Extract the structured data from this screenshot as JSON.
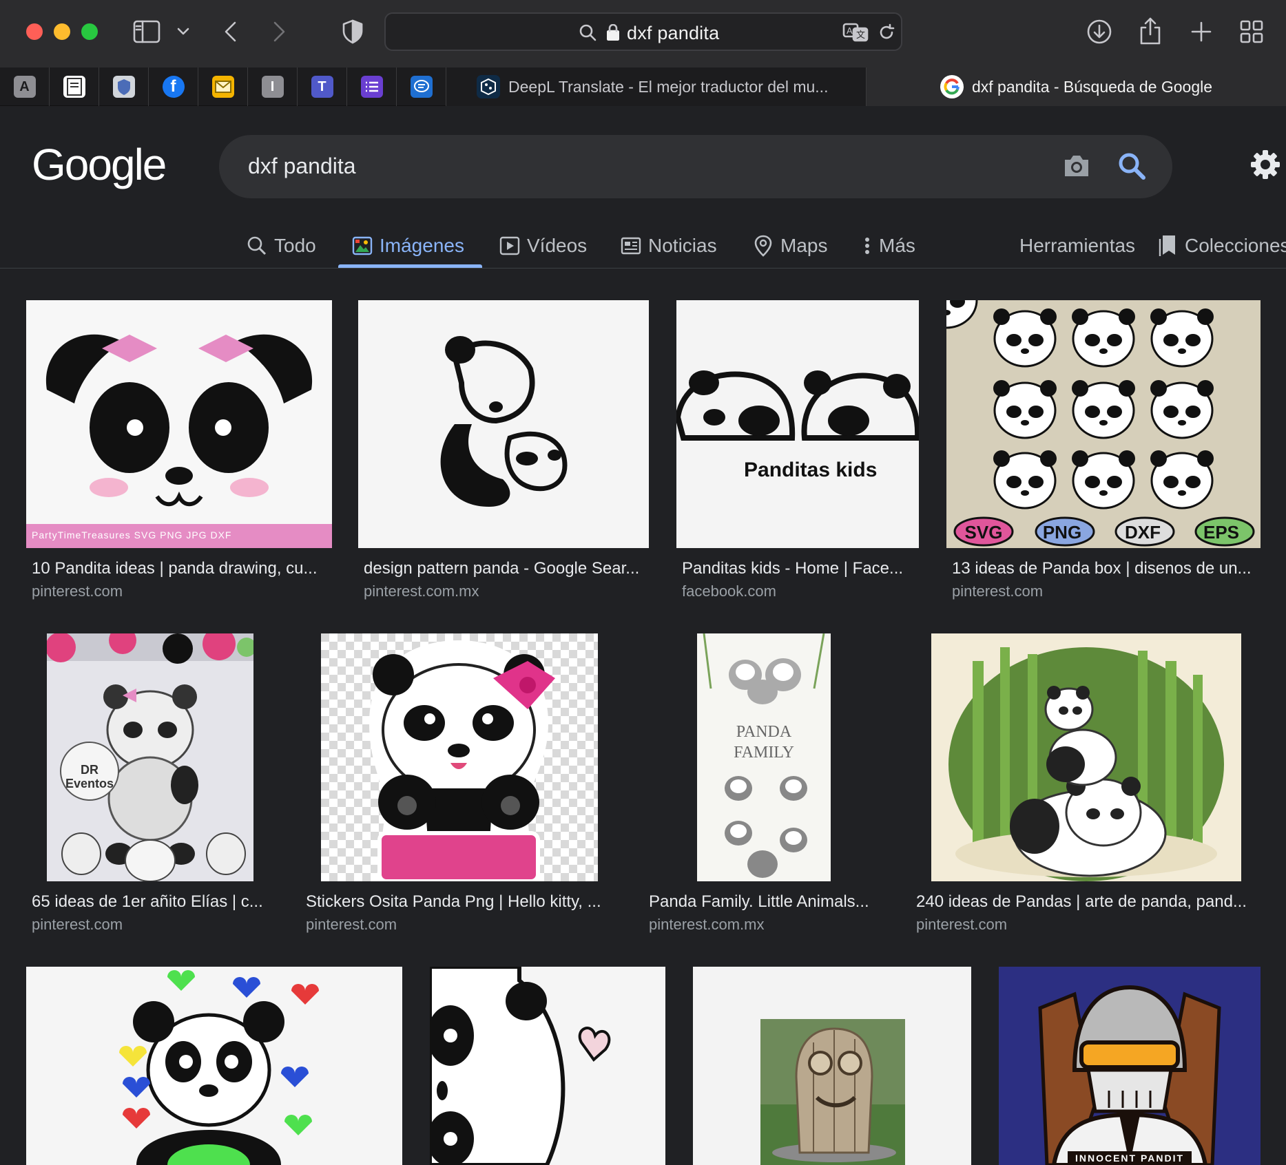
{
  "browser": {
    "url": "dxf pandita",
    "tabs": {
      "inactive_title": "DeepL Translate - El mejor traductor del mu...",
      "active_title": "dxf pandita - Búsqueda de Google"
    },
    "pinned": [
      "A",
      "",
      "",
      "",
      "",
      "I",
      "",
      "",
      ""
    ]
  },
  "google": {
    "logo": "Google",
    "query": "dxf pandita",
    "nav": {
      "all": "Todo",
      "images": "Imágenes",
      "videos": "Vídeos",
      "news": "Noticias",
      "maps": "Maps",
      "more": "Más",
      "tools": "Herramientas",
      "collections": "Colecciones"
    }
  },
  "results": [
    {
      "title": "10 Pandita ideas | panda drawing, cu...",
      "source": "pinterest.com",
      "overlay": "PartyTimeTreasures   SVG  PNG  JPG  DXF"
    },
    {
      "title": "design pattern panda - Google Sear...",
      "source": "pinterest.com.mx"
    },
    {
      "title": "Panditas kids - Home | Face...",
      "source": "facebook.com",
      "overlay": "Panditas kids"
    },
    {
      "title": "13 ideas de Panda box | disenos de un...",
      "source": "pinterest.com",
      "tags": [
        "SVG",
        "PNG",
        "DXF",
        "EPS"
      ]
    },
    {
      "title": "65 ideas de 1er añito Elías | c...",
      "source": "pinterest.com",
      "overlay": "DR Eventos"
    },
    {
      "title": "Stickers Osita Panda Png | Hello kitty, ...",
      "source": "pinterest.com"
    },
    {
      "title": "Panda Family. Little Animals...",
      "source": "pinterest.com.mx",
      "overlay": "PANDA FAMILY"
    },
    {
      "title": "240 ideas de Pandas | arte de panda, pand...",
      "source": "pinterest.com"
    },
    {
      "title": "",
      "source": ""
    },
    {
      "title": "",
      "source": ""
    },
    {
      "title": "",
      "source": ""
    },
    {
      "title": "",
      "source": "",
      "overlay": "INNOCENT PANDIT"
    }
  ],
  "colors": {
    "page_bg": "#202124",
    "accent": "#8ab4f8",
    "search_bg": "#303134"
  }
}
